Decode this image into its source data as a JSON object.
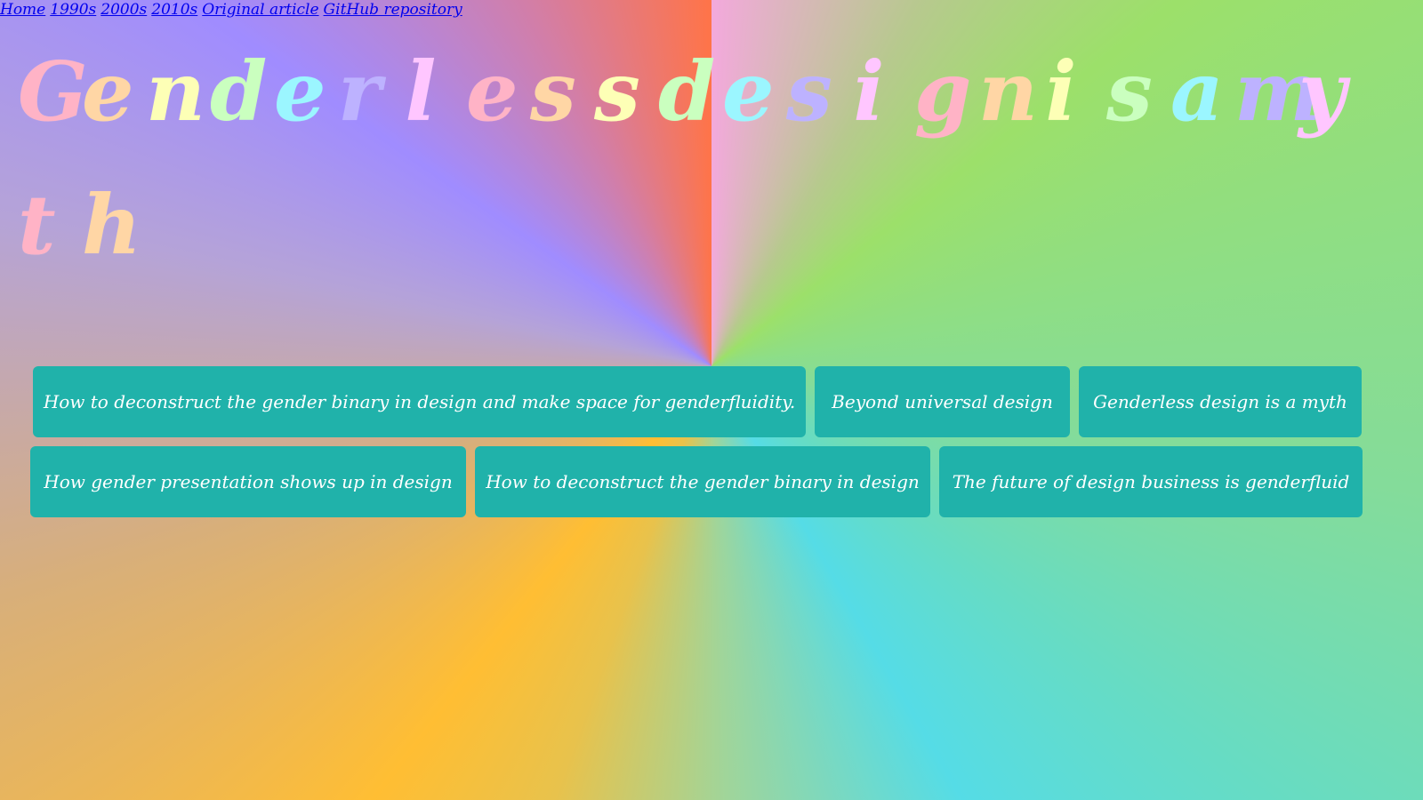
{
  "nav": {
    "home": "Home",
    "y1990s": "1990s",
    "y2000s": "2000s",
    "y2010s": "2010s",
    "original_article": "Original article",
    "github_repository": "GitHub repository"
  },
  "title": {
    "text": "Genderlessdesignisamyth",
    "letters": [
      "G",
      "e",
      "n",
      "d",
      "e",
      "r",
      "l",
      "e",
      "s",
      "s",
      "d",
      "e",
      "s",
      "i",
      "g",
      "n",
      "i",
      "s",
      "a",
      "m",
      "y",
      "t",
      "h"
    ],
    "letter_colors": [
      "#ffb3c6",
      "#ffd6a5",
      "#fdffb6",
      "#caffbf",
      "#9bf6ff",
      "#bdb2ff",
      "#ffc6ff",
      "#ffb3c6",
      "#ffd6a5",
      "#fdffb6",
      "#caffbf",
      "#9bf6ff",
      "#bdb2ff",
      "#ffc6ff",
      "#ffb3c6",
      "#ffd6a5",
      "#fdffb6",
      "#caffbf",
      "#9bf6ff",
      "#bdb2ff",
      "#ffc6ff",
      "#ffb3c6",
      "#ffd6a5"
    ]
  },
  "cards": {
    "row1": [
      "How to deconstruct the gender binary in design and make space for genderfluidity.",
      "Beyond universal design",
      "Genderless design is a myth"
    ],
    "row2": [
      "How gender presentation shows up in design",
      "How to deconstruct the gender binary in design",
      "The future of design business is genderfluid"
    ]
  },
  "colors": {
    "card_background": "#20b2aa",
    "card_text": "#ffffff",
    "link": "#0000ee"
  }
}
